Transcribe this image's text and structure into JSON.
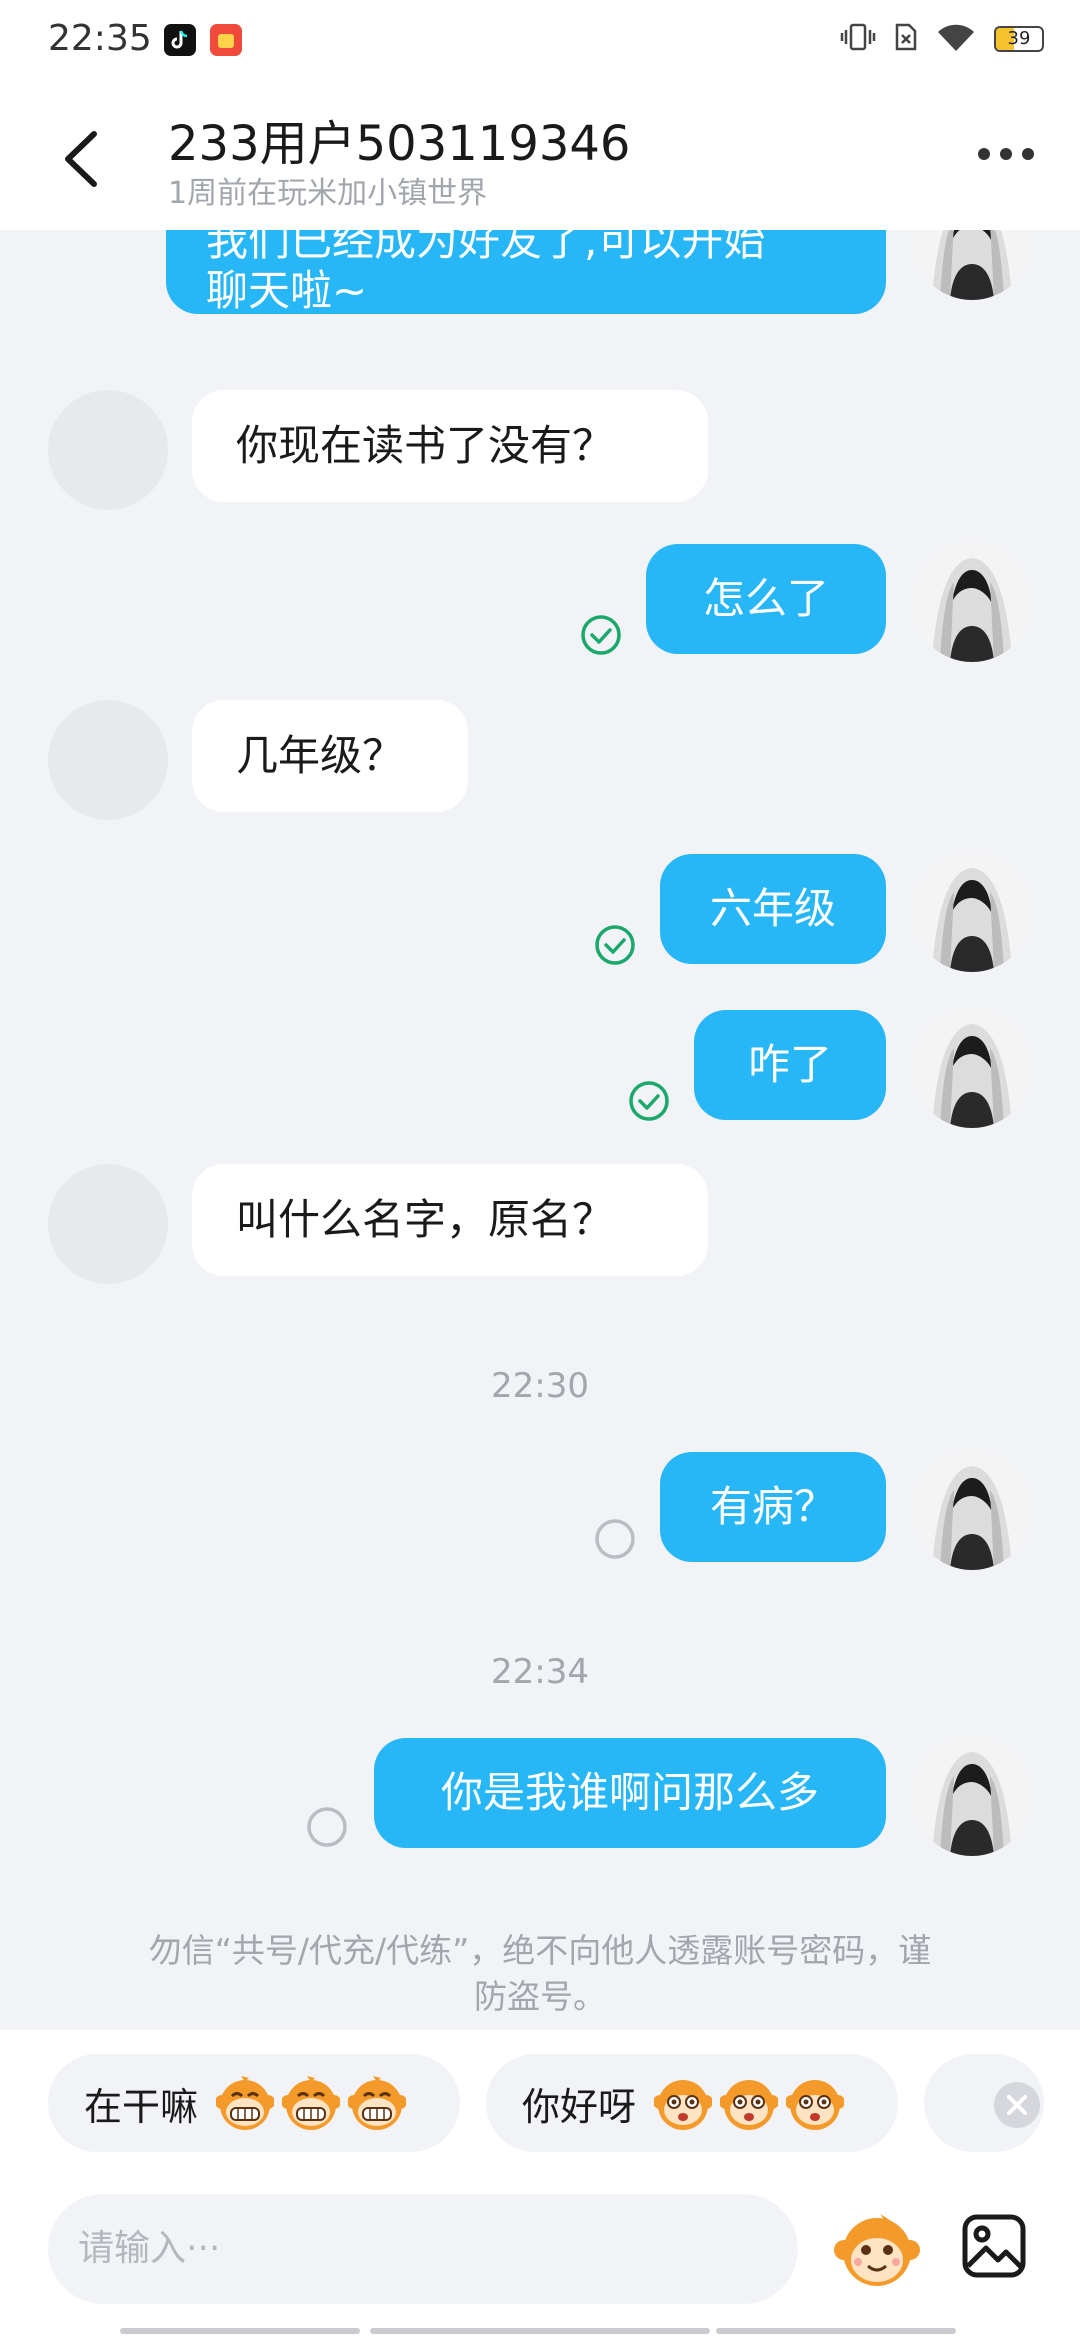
{
  "status_bar": {
    "time": "22:35",
    "battery_level": "39",
    "icons": [
      "tiktok-icon",
      "shopping-app-icon",
      "vibrate-icon",
      "sim-icon",
      "wifi-icon",
      "battery-icon"
    ]
  },
  "header": {
    "title": "233用户503119346",
    "subtitle": "1周前在玩米加小镇世界"
  },
  "messages": [
    {
      "side": "out",
      "text": "我们已经成为好友了,可以开始聊天啦~",
      "text_line1": "我们已经成为好友了,可以开始",
      "text_line2": "聊天啦~"
    },
    {
      "side": "in",
      "text": "你现在读书了没有？"
    },
    {
      "side": "out",
      "text": "怎么了",
      "status": "read"
    },
    {
      "side": "in",
      "text": "几年级？"
    },
    {
      "side": "out",
      "text": "六年级",
      "status": "read"
    },
    {
      "side": "out",
      "text": "咋了",
      "status": "read"
    },
    {
      "side": "in",
      "text": "叫什么名字，原名？"
    },
    {
      "type": "timestamp",
      "text": "22:30"
    },
    {
      "side": "out",
      "text": "有病？",
      "status": "unread"
    },
    {
      "type": "timestamp",
      "text": "22:34"
    },
    {
      "side": "out",
      "text": "你是我谁啊问那么多",
      "status": "unread"
    }
  ],
  "warning": {
    "line1": "勿信“共号/代充/代练”，绝不向他人透露账号密码，谨",
    "line2": "防盗号。"
  },
  "quick_replies": [
    {
      "label": "在干嘛",
      "emoji": "grinning-monkey-emoji"
    },
    {
      "label": "你好呀",
      "emoji": "surprised-monkey-emoji"
    }
  ],
  "input": {
    "placeholder": "请输入···"
  },
  "colors": {
    "outgoing_bubble": "#27b6f6",
    "incoming_bubble": "#ffffff",
    "chat_background": "#f2f3f7",
    "read_check": "#1aa86b"
  }
}
